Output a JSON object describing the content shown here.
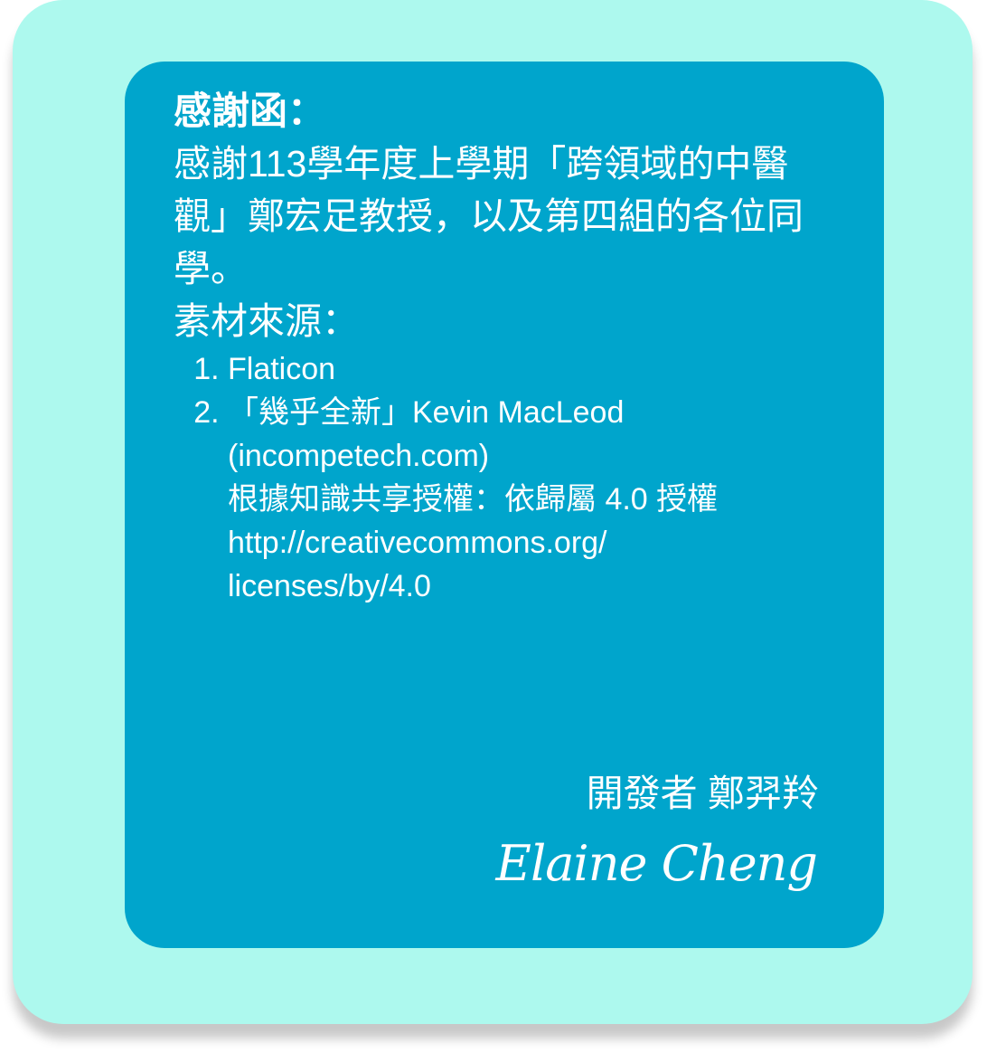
{
  "thanks": {
    "title": "感謝函：",
    "body": "感謝113學年度上學期「跨領域的中醫觀」鄭宏足教授，以及第四組的各位同學。"
  },
  "sources": {
    "title": "素材來源：",
    "items": [
      {
        "lines": [
          "Flaticon"
        ]
      },
      {
        "lines": [
          "「幾乎全新」Kevin MacLeod",
          "(incompetech.com)",
          "根據知識共享授權：依歸屬 4.0 授權",
          "http://creativecommons.org/",
          "licenses/by/4.0"
        ]
      }
    ]
  },
  "developer": {
    "label": "開發者 鄭羿羚",
    "signature": "Elaine Cheng"
  },
  "colors": {
    "outer_background": "#adf9ee",
    "panel_background": "#00a5cc",
    "text": "#ffffff"
  }
}
